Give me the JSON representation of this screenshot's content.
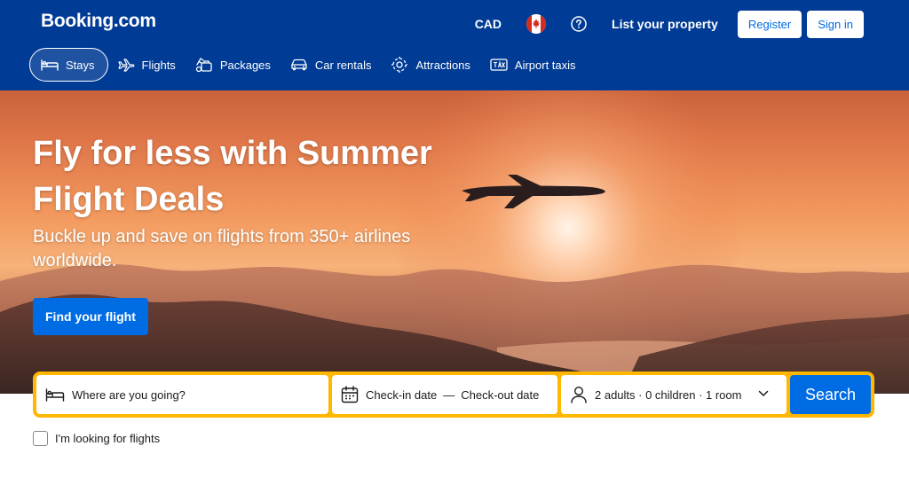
{
  "header": {
    "logo": "Booking.com",
    "currency": "CAD",
    "flag": "canada-flag-icon",
    "list_property": "List your property",
    "register": "Register",
    "sign_in": "Sign in"
  },
  "nav": {
    "items": [
      {
        "label": "Stays",
        "icon": "bed-icon",
        "active": true
      },
      {
        "label": "Flights",
        "icon": "plane-icon"
      },
      {
        "label": "Packages",
        "icon": "packages-icon"
      },
      {
        "label": "Car rentals",
        "icon": "car-icon"
      },
      {
        "label": "Attractions",
        "icon": "attractions-icon"
      },
      {
        "label": "Airport taxis",
        "icon": "taxi-icon"
      }
    ]
  },
  "hero": {
    "title": "Fly for less with Summer Flight Deals",
    "subtitle": "Buckle up and save on flights from 350+ airlines worldwide.",
    "cta": "Find your flight"
  },
  "search": {
    "destination_placeholder": "Where are you going?",
    "checkin": "Check-in date",
    "separator": "—",
    "checkout": "Check-out date",
    "occupancy": "2 adults · 0 children · 1 room",
    "button": "Search"
  },
  "options": {
    "flights_checkbox": "I'm looking for flights",
    "flights_checked": false
  },
  "colors": {
    "header_bg": "#003b95",
    "primary": "#006ce4",
    "search_border": "#ffb700"
  }
}
